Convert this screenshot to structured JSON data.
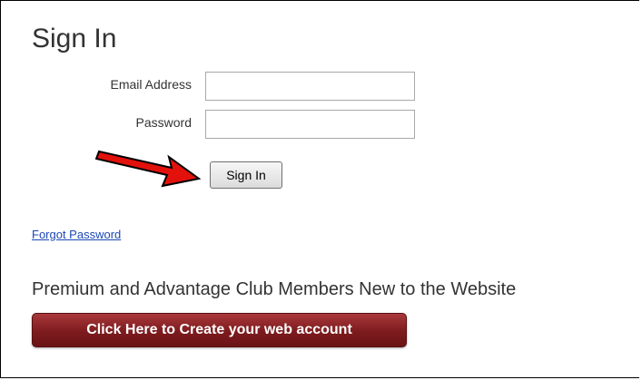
{
  "page": {
    "title": "Sign In"
  },
  "form": {
    "email_label": "Email Address",
    "email_value": "",
    "password_label": "Password",
    "password_value": "",
    "signin_label": "Sign In"
  },
  "links": {
    "forgot_password": "Forgot Password"
  },
  "new_members": {
    "heading": "Premium and Advantage Club Members New to the Website",
    "create_account_label": "Click Here to Create your web account"
  },
  "annotation": {
    "arrow_icon": "red-arrow-icon",
    "arrow_color": "#e3110b"
  },
  "colors": {
    "link": "#1a47b5",
    "create_button": "#7c1b1e"
  }
}
